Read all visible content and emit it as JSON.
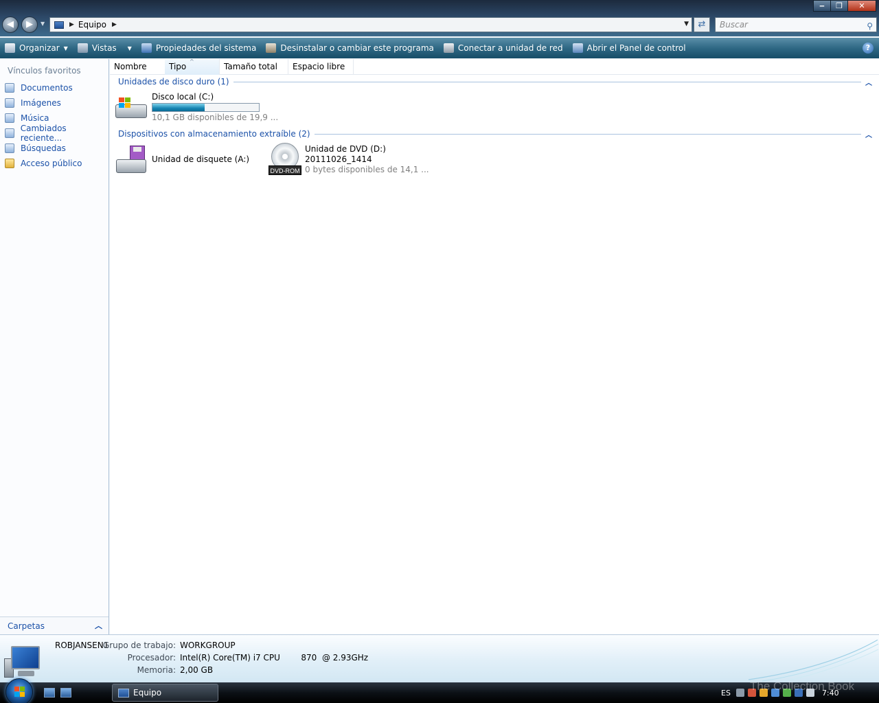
{
  "window": {
    "address_crumb": "Equipo",
    "search_placeholder": "Buscar"
  },
  "toolbar": {
    "organize": "Organizar",
    "views": "Vistas",
    "system_properties": "Propiedades del sistema",
    "uninstall": "Desinstalar o cambiar este programa",
    "map_drive": "Conectar a unidad de red",
    "control_panel": "Abrir el Panel de control",
    "help": "?"
  },
  "nav": {
    "heading": "Vínculos favoritos",
    "items": [
      {
        "label": "Documentos"
      },
      {
        "label": "Imágenes"
      },
      {
        "label": "Música"
      },
      {
        "label": "Cambiados reciente..."
      },
      {
        "label": "Búsquedas"
      },
      {
        "label": "Acceso público"
      }
    ],
    "folders": "Carpetas"
  },
  "columns": [
    "Nombre",
    "Tipo",
    "Tamaño total",
    "Espacio libre"
  ],
  "groups": {
    "hard_disks": {
      "title": "Unidades de disco duro (1)",
      "drives": [
        {
          "name": "Disco local (C:)",
          "free": "10,1 GB disponibles de 19,9 ...",
          "used_fraction": 0.49
        }
      ]
    },
    "removable": {
      "title": "Dispositivos con almacenamiento extraíble (2)",
      "drives": [
        {
          "name": "Unidad de disquete (A:)"
        },
        {
          "name": "Unidad de DVD (D:)",
          "label": "20111026_1414",
          "free": "0 bytes disponibles de 14,1 ...",
          "badge": "DVD-ROM"
        }
      ]
    }
  },
  "details": {
    "computer_name": "ROBJANSEN1",
    "workgroup_label": "Grupo de trabajo:",
    "workgroup": "WORKGROUP",
    "processor_label": "Procesador:",
    "processor": "Intel(R) Core(TM) i7 CPU        870  @ 2.93GHz",
    "memory_label": "Memoria:",
    "memory": "2,00 GB"
  },
  "taskbar": {
    "window_button": "Equipo",
    "language": "ES",
    "clock": "7:40"
  },
  "watermark": "The Collection Book",
  "colors": {
    "link": "#1b51a8",
    "command_bar": "#2f6884",
    "usage_fill": "#1685b3"
  }
}
